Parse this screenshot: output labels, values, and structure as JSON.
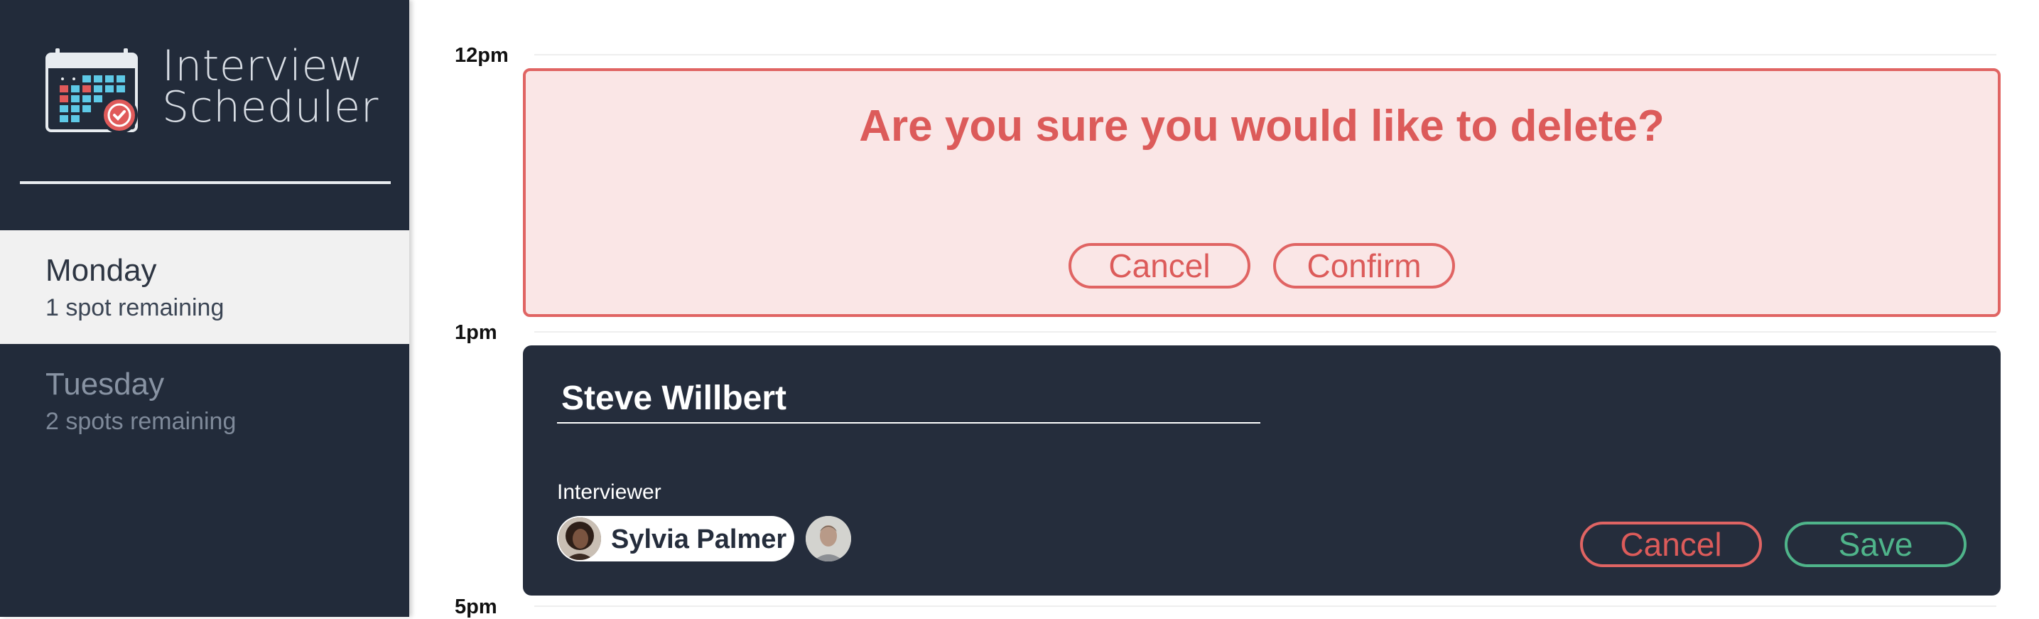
{
  "sidebar": {
    "logo_line1": "Interview",
    "logo_line2": "Scheduler",
    "logo_icon": "calendar-check-icon",
    "days": [
      {
        "name": "Monday",
        "spots": "1 spot remaining",
        "selected": true
      },
      {
        "name": "Tuesday",
        "spots": "2 spots remaining",
        "selected": false
      }
    ]
  },
  "schedule": {
    "times": [
      "12pm",
      "1pm",
      "5pm"
    ],
    "delete_confirm": {
      "message": "Are you sure you would like to delete?",
      "cancel_label": "Cancel",
      "confirm_label": "Confirm"
    },
    "edit_form": {
      "student_name": "Steve Willbert",
      "interviewer_label": "Interviewer",
      "selected_interviewer": "Sylvia Palmer",
      "cancel_label": "Cancel",
      "save_label": "Save"
    }
  },
  "colors": {
    "sidebar_bg": "#222b3a",
    "danger": "#e06463",
    "danger_bg": "#fae6e6",
    "success": "#4fb48a",
    "card_dark": "#252d3c"
  }
}
